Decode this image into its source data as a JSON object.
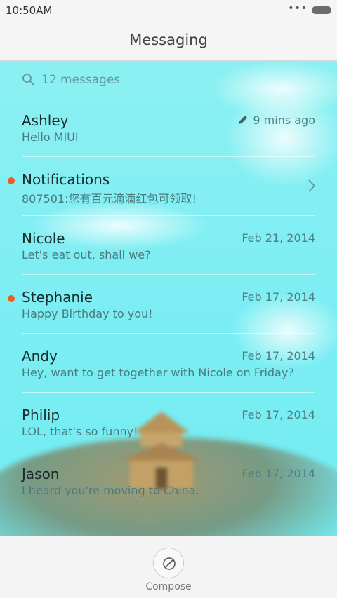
{
  "status_bar": {
    "time": "10:50AM",
    "dots": "•••"
  },
  "header": {
    "title": "Messaging"
  },
  "search": {
    "placeholder": "12 messages",
    "icon": "search-icon"
  },
  "messages": [
    {
      "name": "Ashley",
      "preview": "Hello MIUI",
      "time": "9 mins ago",
      "draft": true,
      "unread": false
    },
    {
      "name": "Notifications",
      "preview": "807501:您有百元滴滴红包可领取!",
      "time": "",
      "draft": false,
      "unread": true,
      "chevron": true
    },
    {
      "name": "Nicole",
      "preview": "Let's eat out, shall we?",
      "time": "Feb 21, 2014",
      "draft": false,
      "unread": false
    },
    {
      "name": "Stephanie",
      "preview": "Happy Birthday to you!",
      "time": "Feb 17, 2014",
      "draft": false,
      "unread": true
    },
    {
      "name": "Andy",
      "preview": "Hey, want to get together with Nicole on Friday?",
      "time": "Feb 17, 2014",
      "draft": false,
      "unread": false
    },
    {
      "name": "Philip",
      "preview": "LOL, that's so funny!",
      "time": "Feb 17, 2014",
      "draft": false,
      "unread": false
    },
    {
      "name": "Jason",
      "preview": "I heard you're moving to China.",
      "time": "Feb 17, 2014",
      "draft": false,
      "unread": false
    }
  ],
  "compose": {
    "label": "Compose"
  },
  "colors": {
    "accent_unread": "#f25a1e",
    "background_sky": "#7eeef3",
    "bar_background": "#f5f5f5"
  }
}
